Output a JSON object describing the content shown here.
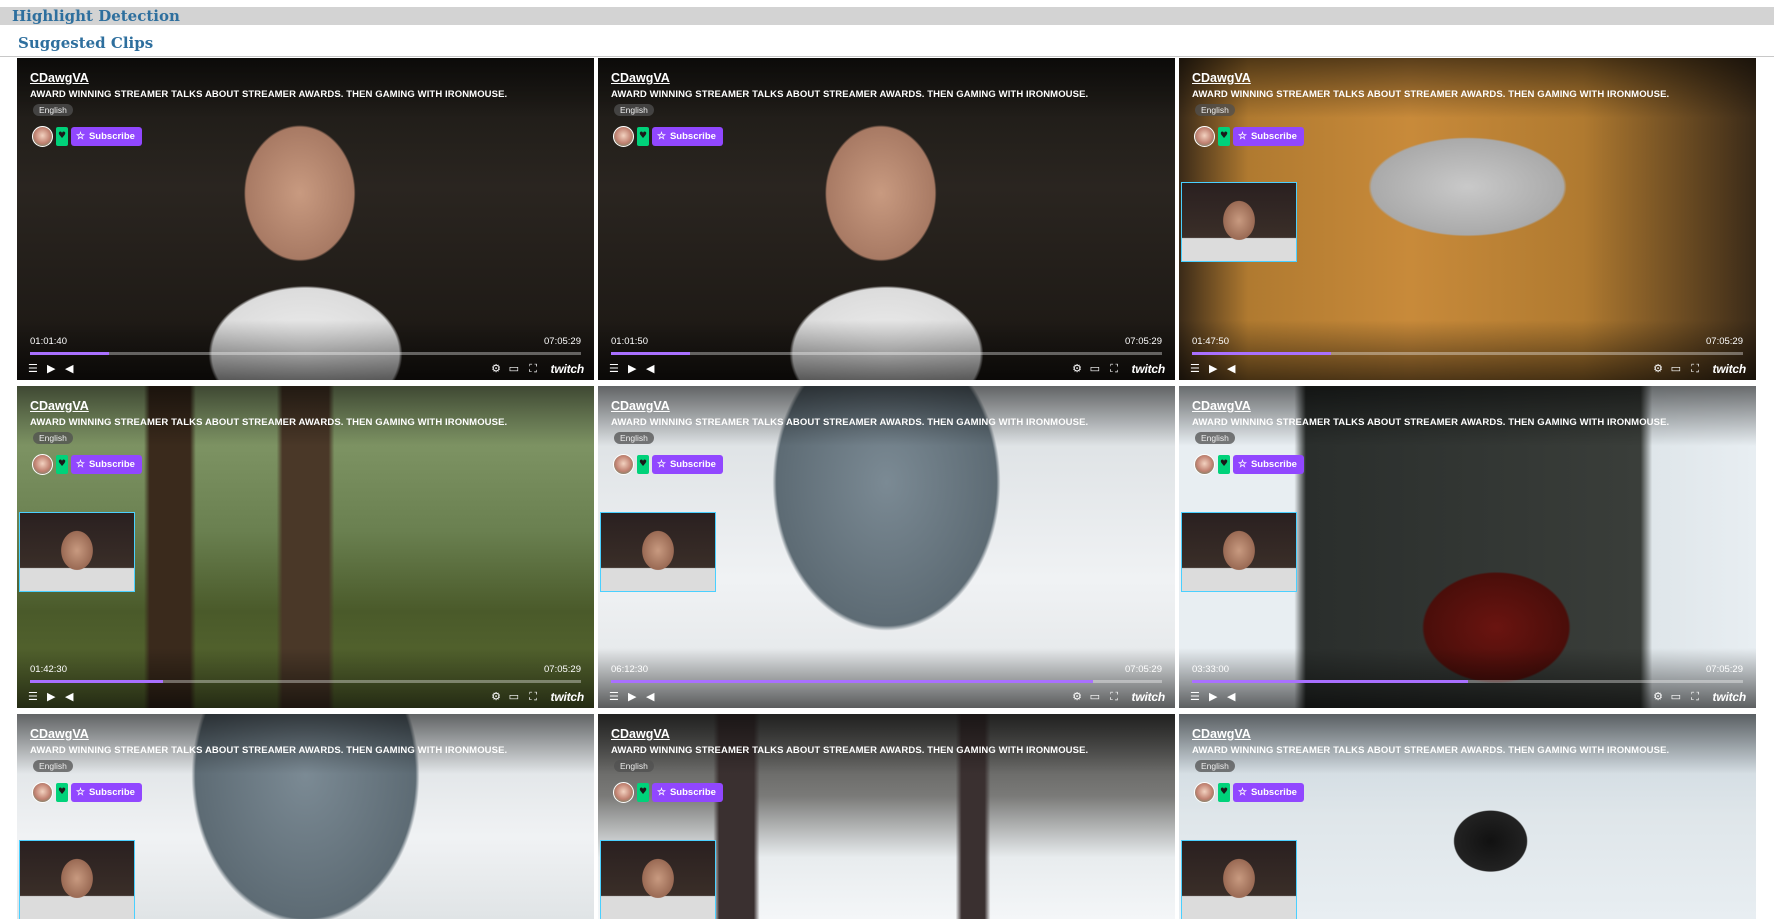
{
  "page": {
    "header_title": "Highlight Detection",
    "section_title": "Suggested Clips"
  },
  "colors": {
    "header_text": "#2e6f9e",
    "header_bg": "#d3d3d3",
    "subscribe_purple": "#9147ff",
    "follow_green": "#00d27a",
    "progress_purple": "#a970ff",
    "cam_border": "#4ad0ff"
  },
  "icons": {
    "follow": "heart-icon",
    "subscribe": "star-icon",
    "list": "list-icon",
    "play": "play-icon",
    "volume": "volume-icon",
    "settings": "gear-icon",
    "clip": "clip-icon",
    "fullscreen": "fullscreen-icon"
  },
  "clips": [
    {
      "channel": "CDawgVA",
      "title": "AWARD WINNING STREAMER TALKS ABOUT STREAMER AWARDS. THEN GAMING WITH IRONMOUSE.",
      "language": "English",
      "subscribe_label": "Subscribe",
      "current_time": "01:01:40",
      "duration": "07:05:29",
      "progress": 0.143,
      "logo": "twitch"
    },
    {
      "channel": "CDawgVA",
      "title": "AWARD WINNING STREAMER TALKS ABOUT STREAMER AWARDS. THEN GAMING WITH IRONMOUSE.",
      "language": "English",
      "subscribe_label": "Subscribe",
      "current_time": "01:01:50",
      "duration": "07:05:29",
      "progress": 0.144,
      "logo": "twitch"
    },
    {
      "channel": "CDawgVA",
      "title": "AWARD WINNING STREAMER TALKS ABOUT STREAMER AWARDS. THEN GAMING WITH IRONMOUSE.",
      "language": "English",
      "subscribe_label": "Subscribe",
      "current_time": "01:47:50",
      "duration": "07:05:29",
      "progress": 0.253,
      "logo": "twitch"
    },
    {
      "channel": "CDawgVA",
      "title": "AWARD WINNING STREAMER TALKS ABOUT STREAMER AWARDS. THEN GAMING WITH IRONMOUSE.",
      "language": "English",
      "subscribe_label": "Subscribe",
      "current_time": "01:42:30",
      "duration": "07:05:29",
      "progress": 0.241,
      "logo": "twitch"
    },
    {
      "channel": "CDawgVA",
      "title": "AWARD WINNING STREAMER TALKS ABOUT STREAMER AWARDS. THEN GAMING WITH IRONMOUSE.",
      "language": "English",
      "subscribe_label": "Subscribe",
      "current_time": "06:12:30",
      "duration": "07:05:29",
      "progress": 0.875,
      "logo": "twitch"
    },
    {
      "channel": "CDawgVA",
      "title": "AWARD WINNING STREAMER TALKS ABOUT STREAMER AWARDS. THEN GAMING WITH IRONMOUSE.",
      "language": "English",
      "subscribe_label": "Subscribe",
      "current_time": "03:33:00",
      "duration": "07:05:29",
      "progress": 0.5,
      "logo": "twitch"
    },
    {
      "channel": "CDawgVA",
      "title": "AWARD WINNING STREAMER TALKS ABOUT STREAMER AWARDS. THEN GAMING WITH IRONMOUSE.",
      "language": "English",
      "subscribe_label": "Subscribe"
    },
    {
      "channel": "CDawgVA",
      "title": "AWARD WINNING STREAMER TALKS ABOUT STREAMER AWARDS. THEN GAMING WITH IRONMOUSE.",
      "language": "English",
      "subscribe_label": "Subscribe"
    },
    {
      "channel": "CDawgVA",
      "title": "AWARD WINNING STREAMER TALKS ABOUT STREAMER AWARDS. THEN GAMING WITH IRONMOUSE.",
      "language": "English",
      "subscribe_label": "Subscribe"
    }
  ]
}
